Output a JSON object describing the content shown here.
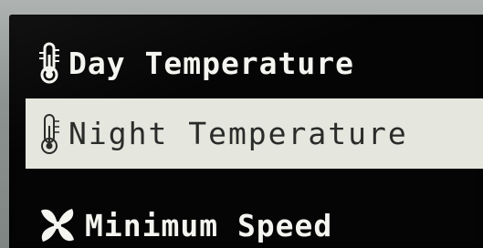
{
  "menu": {
    "items": [
      {
        "label": "Day Temperature",
        "icon": "thermometer-icon",
        "selected": false
      },
      {
        "label": "Night Temperature",
        "icon": "thermometer-icon",
        "selected": true
      },
      {
        "label": "Minimum Speed",
        "icon": "fan-icon",
        "selected": false
      }
    ]
  },
  "colors": {
    "screen_background": "#050505",
    "text_normal": "#f4f5f0",
    "highlight_background": "#e5e6dd",
    "text_highlighted": "#2a2c2a"
  }
}
